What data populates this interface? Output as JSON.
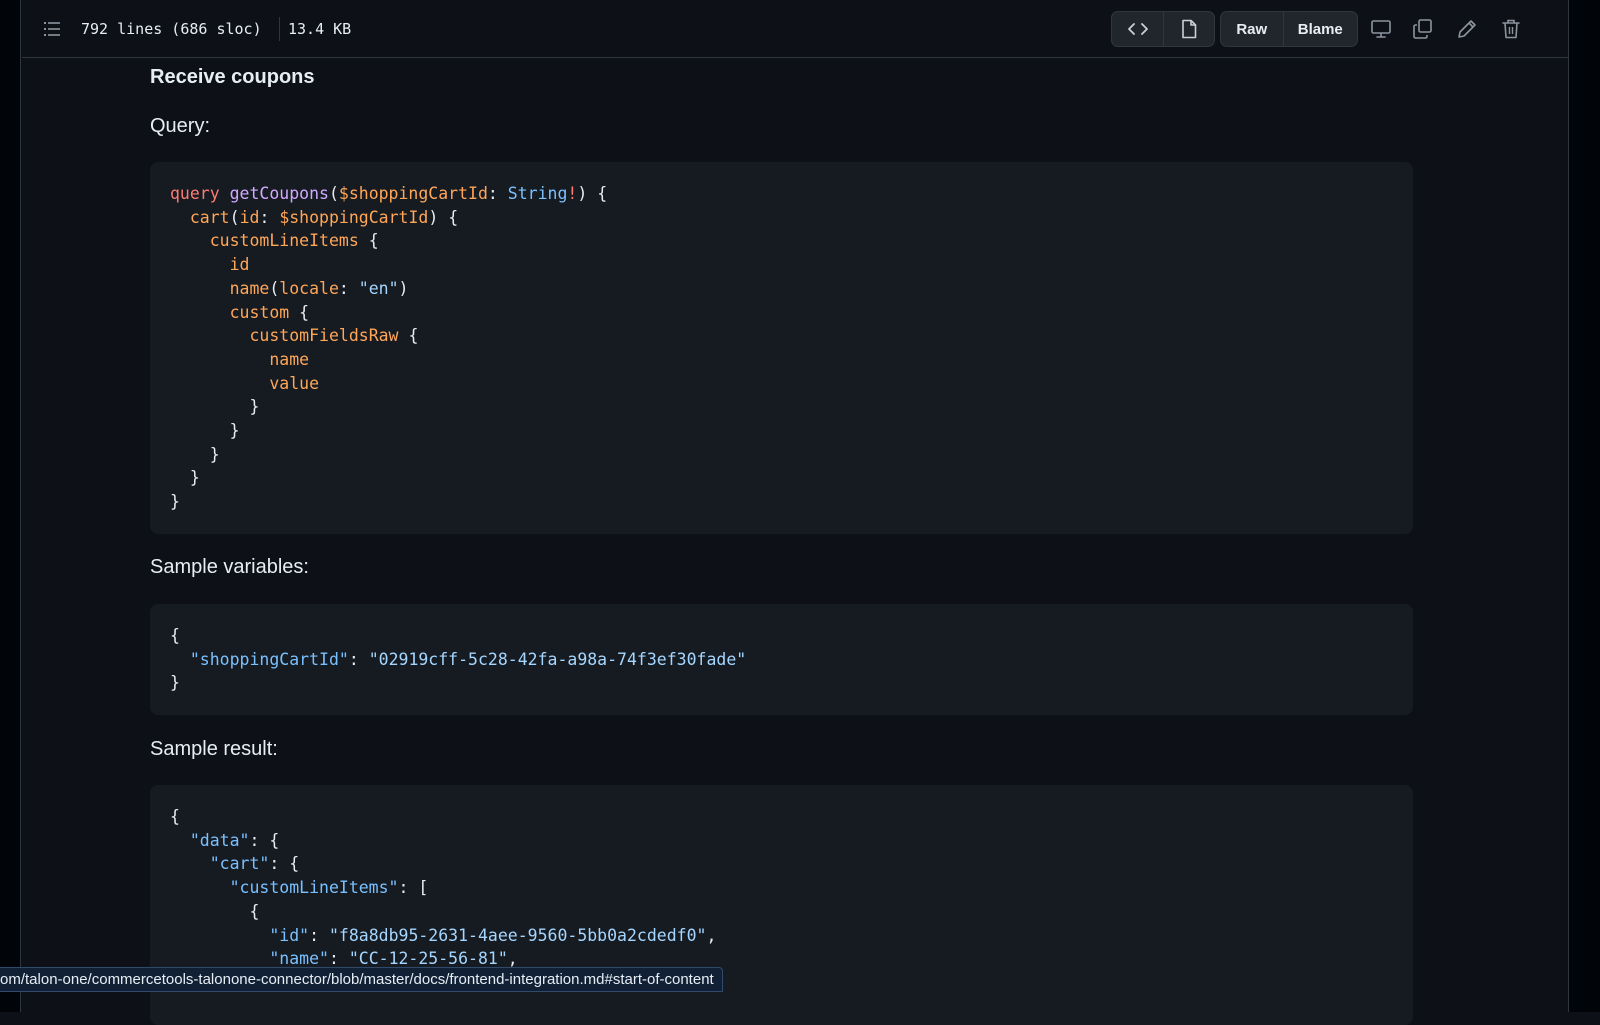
{
  "file_header": {
    "lines_info": "792 lines (686 sloc)",
    "size": "13.4 KB",
    "raw_label": "Raw",
    "blame_label": "Blame",
    "icons": [
      "outline-icon",
      "code-view-icon",
      "file-preview-icon",
      "desktop-icon",
      "copy-icon",
      "pencil-icon",
      "trash-icon"
    ]
  },
  "content": {
    "heading": "Receive coupons",
    "query_label": "Query:",
    "query_code": [
      "query getCoupons($shoppingCartId: String!) {",
      "  cart(id: $shoppingCartId) {",
      "    customLineItems {",
      "      id",
      "      name(locale: \"en\")",
      "      custom {",
      "        customFieldsRaw {",
      "          name",
      "          value",
      "        }",
      "      }",
      "    }",
      "  }",
      "}"
    ],
    "variables_label": "Sample variables:",
    "variables_code": {
      "open": "{",
      "key": "\"shoppingCartId\"",
      "colon": ": ",
      "value": "\"02919cff-5c28-42fa-a98a-74f3ef30fade\"",
      "close": "}"
    },
    "result_label": "Sample result:",
    "result_code": {
      "data_key": "\"data\"",
      "cart_key": "\"cart\"",
      "items_key": "\"customLineItems\"",
      "id_key": "\"id\"",
      "id_value": "\"f8a8db95-2631-4aee-9560-5bb0a2cdedf0\"",
      "name_key": "\"name\"",
      "name_value": "\"CC-12-25-56-81\""
    }
  },
  "status_bar": {
    "url": "om/talon-one/commercetools-talonone-connector/blob/master/docs/frontend-integration.md#start-of-content"
  },
  "colors": {
    "background": "#0d1117",
    "code_background": "#161b22",
    "keyword": "#ff7b72",
    "function": "#d2a8ff",
    "property": "#ffa657",
    "string": "#a5d6ff",
    "type": "#79c0ff"
  }
}
